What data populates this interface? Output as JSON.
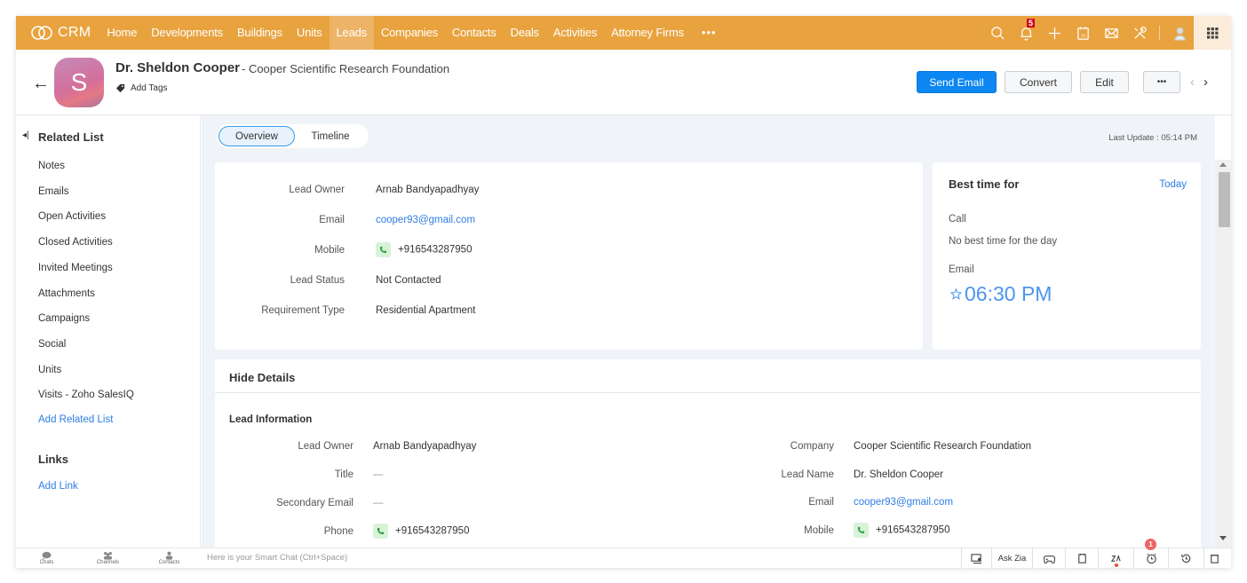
{
  "app": {
    "brand": "CRM",
    "nav": [
      {
        "label": "Home",
        "active": false
      },
      {
        "label": "Developments",
        "active": false
      },
      {
        "label": "Buildings",
        "active": false
      },
      {
        "label": "Units",
        "active": false
      },
      {
        "label": "Leads",
        "active": true
      },
      {
        "label": "Companies",
        "active": false
      },
      {
        "label": "Contacts",
        "active": false
      },
      {
        "label": "Deals",
        "active": false
      },
      {
        "label": "Activities",
        "active": false
      },
      {
        "label": "Attorney Firms",
        "active": false
      }
    ],
    "nav_more": "•••",
    "notification_count": "5",
    "icons": [
      "search-icon",
      "bell-icon",
      "plus-icon",
      "calendar-icon",
      "mail-icon",
      "tools-icon",
      "user-avatar-icon",
      "app-grid-icon"
    ]
  },
  "record": {
    "avatar_letter": "S",
    "name": "Dr. Sheldon Cooper",
    "company": "- Cooper Scientific Research Foundation",
    "add_tags": "Add Tags",
    "buttons": {
      "send_email": "Send Email",
      "convert": "Convert",
      "edit": "Edit",
      "more": "•••"
    },
    "prev": "‹",
    "next": "›"
  },
  "sidebar": {
    "related_heading": "Related List",
    "items": [
      "Notes",
      "Emails",
      "Open Activities",
      "Closed Activities",
      "Invited Meetings",
      "Attachments",
      "Campaigns",
      "Social",
      "Units",
      "Visits - Zoho SalesIQ"
    ],
    "add_related": "Add Related List",
    "links_heading": "Links",
    "add_link": "Add Link"
  },
  "tabs": {
    "overview": "Overview",
    "timeline": "Timeline",
    "active": "Overview"
  },
  "last_update": "Last Update : 05:14 PM",
  "summary": {
    "fields": [
      {
        "label": "Lead Owner",
        "value": "Arnab Bandyapadhyay",
        "type": "text"
      },
      {
        "label": "Email",
        "value": "cooper93@gmail.com",
        "type": "link"
      },
      {
        "label": "Mobile",
        "value": "+916543287950",
        "type": "phone"
      },
      {
        "label": "Lead Status",
        "value": "Not Contacted",
        "type": "text"
      },
      {
        "label": "Requirement Type",
        "value": "Residential Apartment",
        "type": "text"
      }
    ]
  },
  "best_time": {
    "title": "Best time for",
    "today": "Today",
    "call_label": "Call",
    "call_value": "No best time for the day",
    "email_label": "Email",
    "email_time": "06:30 PM"
  },
  "details": {
    "hide_label": "Hide Details",
    "section_title": "Lead Information",
    "left": [
      {
        "label": "Lead Owner",
        "value": "Arnab Bandyapadhyay",
        "type": "text"
      },
      {
        "label": "Title",
        "value": "—",
        "type": "empty"
      },
      {
        "label": "Secondary Email",
        "value": "—",
        "type": "empty"
      },
      {
        "label": "Phone",
        "value": "+916543287950",
        "type": "phone"
      }
    ],
    "right": [
      {
        "label": "Company",
        "value": "Cooper Scientific Research Foundation",
        "type": "text"
      },
      {
        "label": "Lead Name",
        "value": "Dr. Sheldon Cooper",
        "type": "text"
      },
      {
        "label": "Email",
        "value": "cooper93@gmail.com",
        "type": "link"
      },
      {
        "label": "Mobile",
        "value": "+916543287950",
        "type": "phone"
      }
    ]
  },
  "bottombar": {
    "chats": "Chats",
    "channels": "Channels",
    "contacts": "Contacts",
    "smartchat_placeholder": "Here is your Smart Chat (Ctrl+Space)",
    "ask_zia": "Ask Zia",
    "alarm_count": "1"
  },
  "colors": {
    "nav_bg": "#e8a33f",
    "accent_blue": "#0b86f2",
    "link": "#2f7ee3"
  }
}
